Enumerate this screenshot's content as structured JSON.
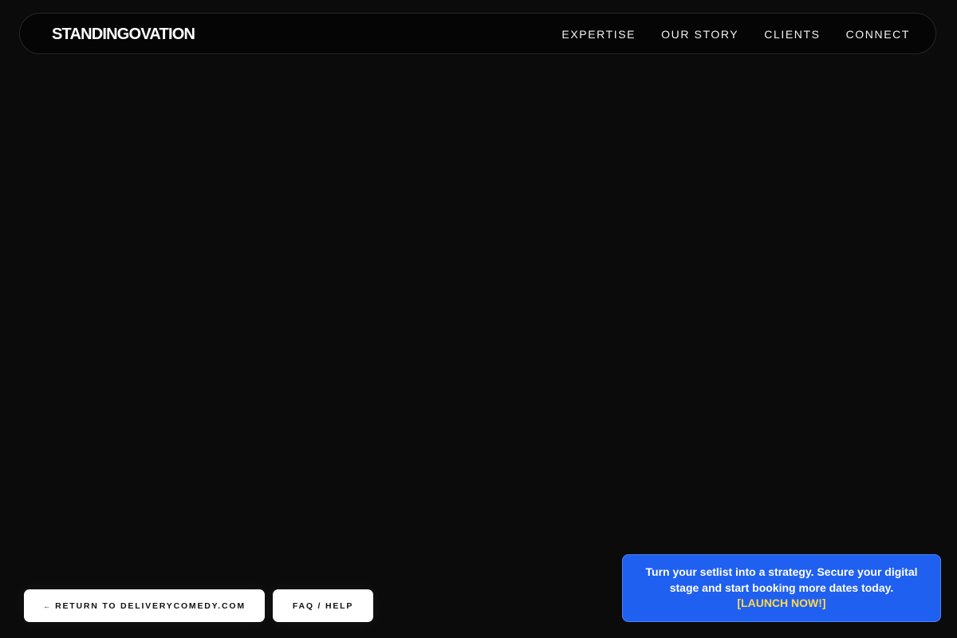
{
  "header": {
    "brand": "STANDINGOVATION",
    "nav": [
      {
        "label": "EXPERTISE"
      },
      {
        "label": "OUR STORY"
      },
      {
        "label": "CLIENTS"
      },
      {
        "label": "CONNECT"
      }
    ]
  },
  "footer_buttons": {
    "return_arrow": "←",
    "return_label": "RETURN TO DELIVERYCOMEDY.COM",
    "faq_label": "FAQ / HELP"
  },
  "promo": {
    "text": "Turn your setlist into a strategy. Secure your digital stage and start booking more dates today.",
    "cta": "[LAUNCH NOW!]"
  },
  "colors": {
    "background": "#0b0b0b",
    "promo_background": "#2060f0",
    "promo_cta": "#ffd84a",
    "button_background": "#ffffff"
  }
}
